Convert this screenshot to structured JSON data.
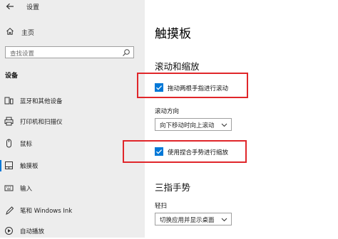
{
  "window": {
    "title": "设置"
  },
  "sidebar": {
    "home_label": "主页",
    "search_placeholder": "查找设置",
    "section_label": "设备",
    "items": [
      {
        "label": "蓝牙和其他设备",
        "icon": "bluetooth-devices-icon"
      },
      {
        "label": "打印机和扫描仪",
        "icon": "printer-icon"
      },
      {
        "label": "鼠标",
        "icon": "mouse-icon"
      },
      {
        "label": "触摸板",
        "icon": "touchpad-icon",
        "active": true
      },
      {
        "label": "输入",
        "icon": "keyboard-icon"
      },
      {
        "label": "笔和 Windows Ink",
        "icon": "pen-icon"
      },
      {
        "label": "自动播放",
        "icon": "autoplay-icon"
      }
    ]
  },
  "main": {
    "title": "触摸板",
    "scroll_zoom": {
      "heading": "滚动和缩放",
      "two_finger_scroll": {
        "label": "拖动两根手指进行滚动",
        "checked": true
      },
      "scroll_direction": {
        "label": "滚动方向",
        "value": "向下移动时向上滚动"
      },
      "pinch_zoom": {
        "label": "使用捏合手势进行缩放",
        "checked": true
      }
    },
    "three_finger": {
      "heading": "三指手势",
      "swipe": {
        "label": "轻扫",
        "value": "切换应用并显示桌面"
      }
    }
  },
  "colors": {
    "accent": "#0078d7",
    "highlight": "#e0262a"
  }
}
